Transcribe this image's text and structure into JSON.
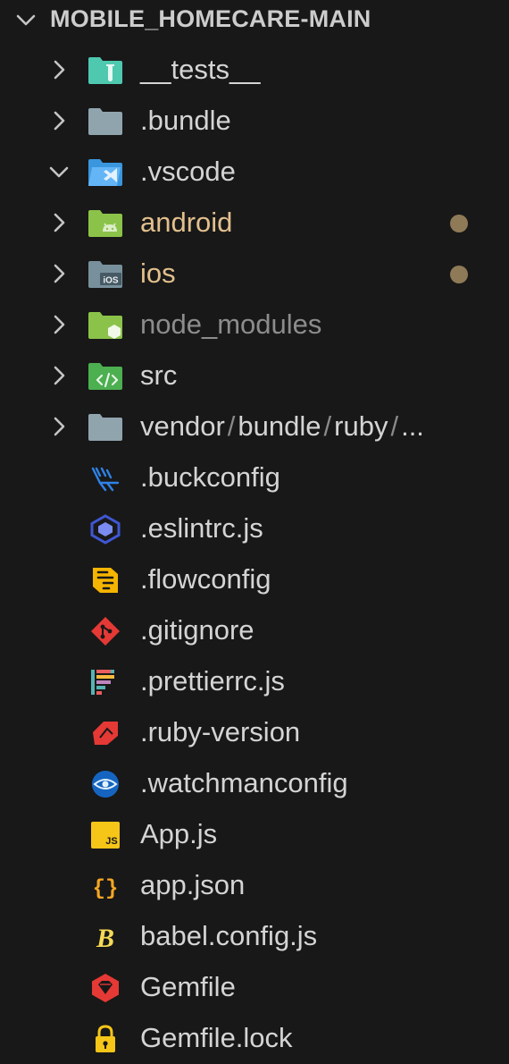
{
  "explorer": {
    "root_title": "MOBILE_HOMECARE-MAIN",
    "root_expanded": true,
    "folders": [
      {
        "label": "__tests__",
        "icon": "tests-folder-icon",
        "expanded": false,
        "status": "none"
      },
      {
        "label": ".bundle",
        "icon": "folder-icon",
        "expanded": false,
        "status": "none"
      },
      {
        "label": ".vscode",
        "icon": "vscode-folder-icon",
        "expanded": true,
        "status": "none"
      },
      {
        "label": "android",
        "icon": "android-folder-icon",
        "expanded": false,
        "status": "modified"
      },
      {
        "label": "ios",
        "icon": "ios-folder-icon",
        "expanded": false,
        "status": "modified"
      },
      {
        "label": "node_modules",
        "icon": "node-folder-icon",
        "expanded": false,
        "status": "ignored"
      },
      {
        "label": "src",
        "icon": "src-folder-icon",
        "expanded": false,
        "status": "none"
      },
      {
        "label": "vendor",
        "icon": "folder-icon",
        "expanded": false,
        "status": "none",
        "compact_parts": [
          "vendor",
          "bundle",
          "ruby",
          "..."
        ],
        "separator": "/"
      }
    ],
    "files": [
      {
        "label": ".buckconfig",
        "icon": "buck-icon"
      },
      {
        "label": ".eslintrc.js",
        "icon": "eslint-icon"
      },
      {
        "label": ".flowconfig",
        "icon": "flow-icon"
      },
      {
        "label": ".gitignore",
        "icon": "git-icon"
      },
      {
        "label": ".prettierrc.js",
        "icon": "prettier-icon"
      },
      {
        "label": ".ruby-version",
        "icon": "ruby-icon"
      },
      {
        "label": ".watchmanconfig",
        "icon": "watchman-icon"
      },
      {
        "label": "App.js",
        "icon": "javascript-icon"
      },
      {
        "label": "app.json",
        "icon": "json-icon"
      },
      {
        "label": "babel.config.js",
        "icon": "babel-icon"
      },
      {
        "label": "Gemfile",
        "icon": "gemfile-icon"
      },
      {
        "label": "Gemfile.lock",
        "icon": "lock-icon"
      }
    ]
  },
  "colors": {
    "background": "#181818",
    "text": "#d4d4d4",
    "modified": "#e2c08d",
    "ignored": "#8c8c8c",
    "modified_dot": "#8f7a57"
  }
}
